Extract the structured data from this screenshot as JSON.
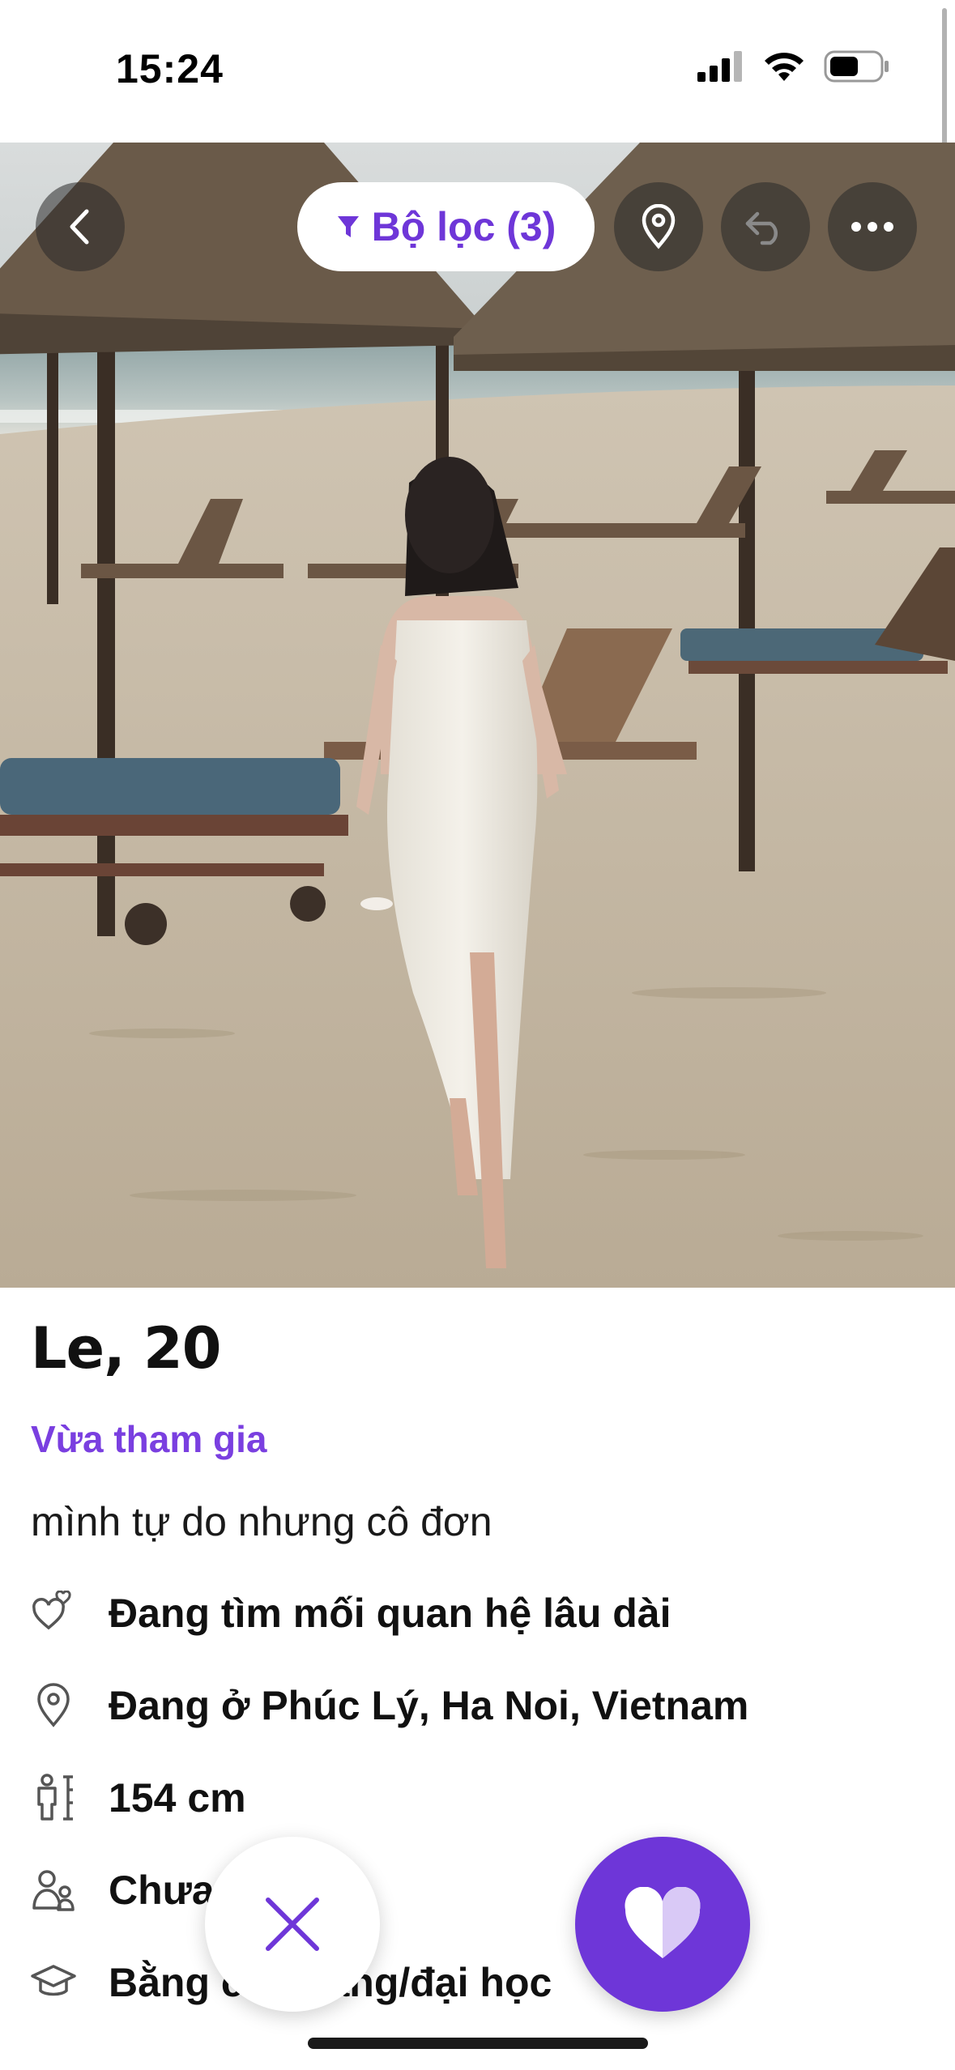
{
  "status_bar": {
    "time": "15:24"
  },
  "top_bar": {
    "filter_label": "Bộ lọc (3)"
  },
  "profile": {
    "name_age": "Le, 20",
    "joined_label": "Vừa tham gia",
    "bio": "mình tự do nhưng cô đơn",
    "attributes": [
      {
        "icon": "hearts-icon",
        "text": "Đang tìm mối quan hệ lâu dài"
      },
      {
        "icon": "location-pin-icon",
        "text": "Đang ở Phúc Lý, Ha Noi, Vietnam"
      },
      {
        "icon": "height-icon",
        "text": "154 cm"
      },
      {
        "icon": "people-icon",
        "text": "Chưa có con"
      },
      {
        "icon": "graduation-cap-icon",
        "text": "Bằng cao đẳng/đại học"
      }
    ]
  },
  "colors": {
    "accent": "#6e36d8",
    "joined": "#7a3fe0"
  }
}
